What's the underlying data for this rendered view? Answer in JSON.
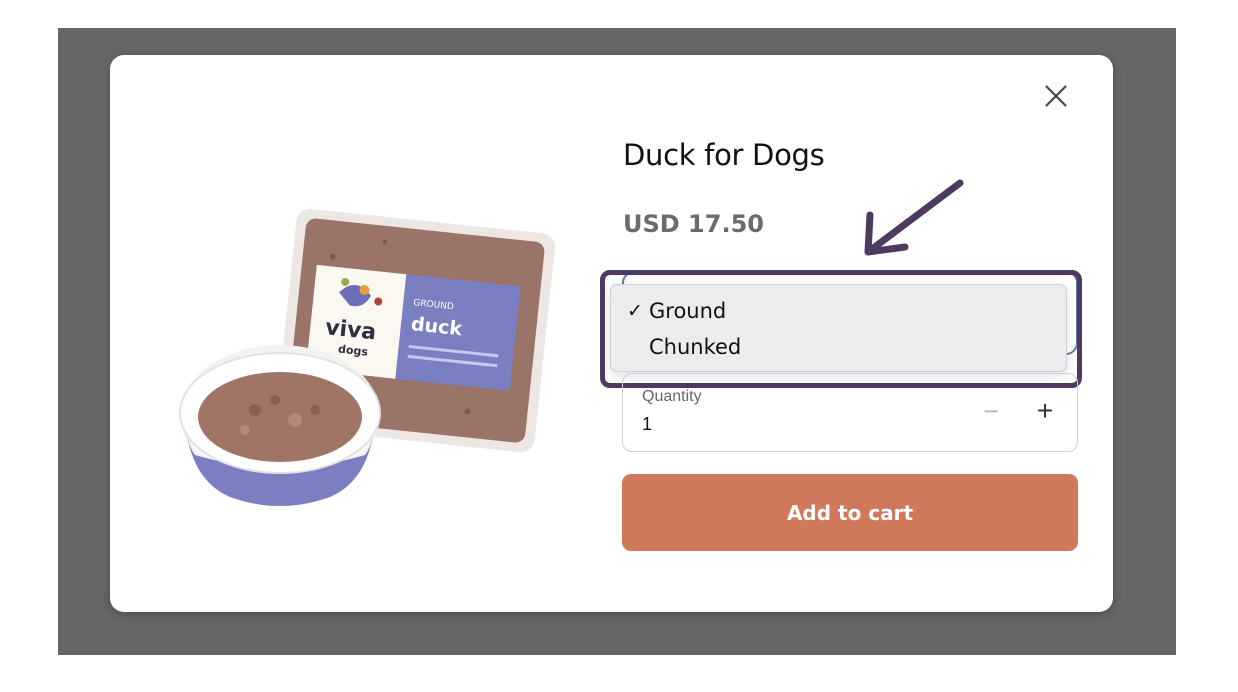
{
  "product": {
    "title": "Duck for Dogs",
    "price": "USD 17.50",
    "package_label": {
      "brand": "viva",
      "brand_sub": "dogs",
      "type": "GROUND",
      "flavor": "duck"
    }
  },
  "variant": {
    "options": [
      {
        "label": "Ground",
        "selected": true,
        "check": "✓"
      },
      {
        "label": "Chunked",
        "selected": false,
        "check": ""
      }
    ]
  },
  "quantity": {
    "label": "Quantity",
    "value": "1",
    "minus": "−",
    "plus": "+"
  },
  "cart": {
    "button_label": "Add to cart"
  },
  "icons": {
    "close": "close-icon"
  },
  "colors": {
    "backdrop": "#666666",
    "cart_button": "#d0785b",
    "annotation": "#4e3a5f",
    "package_blue": "#7a7fc2",
    "select_border": "#5b7da8"
  }
}
